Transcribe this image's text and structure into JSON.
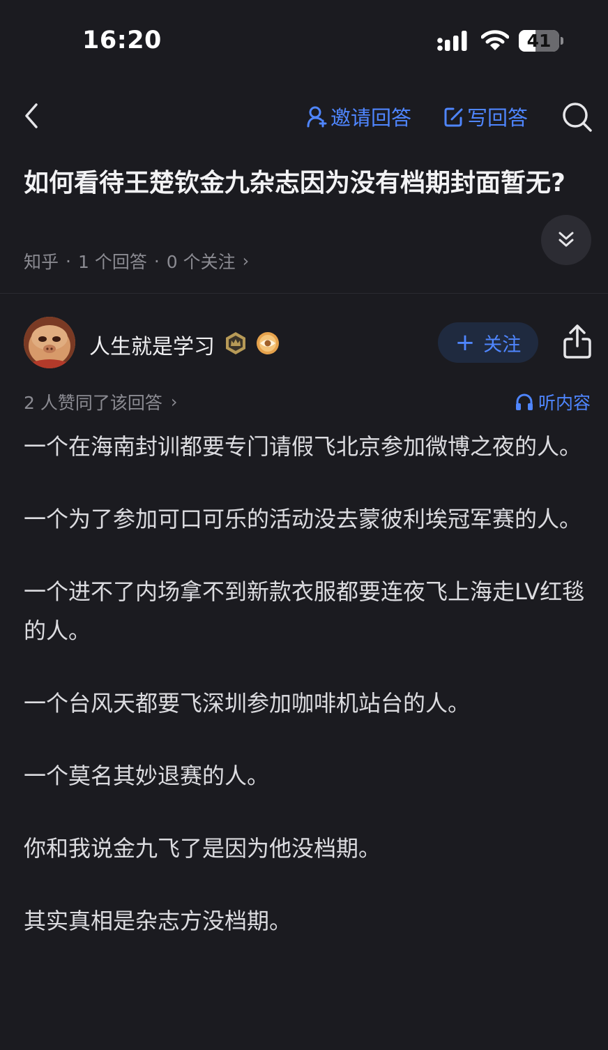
{
  "status_bar": {
    "time": "16:20",
    "battery_level": "41",
    "battery_percent": 41,
    "icons": [
      "signal-icon",
      "wifi-icon",
      "battery-icon"
    ]
  },
  "nav": {
    "back_icon": "chevron-left-icon",
    "invite_label": "邀请回答",
    "write_label": "写回答",
    "search_icon": "search-icon",
    "accent_color": "#4f86ff"
  },
  "question": {
    "title": "如何看待王楚钦金九杂志因为没有档期封面暂无?",
    "meta": {
      "source": "知乎",
      "answers": "1 个回答",
      "follows": "0 个关注"
    }
  },
  "answer": {
    "author": {
      "name": "人生就是学习",
      "badges": [
        "crown-badge-icon",
        "eye-badge-icon"
      ]
    },
    "follow_label": "关注",
    "upvote_text": "2 人赞同了该回答",
    "listen_label": "听内容",
    "paragraphs": [
      "一个在海南封训都要专门请假飞北京参加微博之夜的人。",
      "一个为了参加可口可乐的活动没去蒙彼利埃冠军赛的人。",
      "一个进不了内场拿不到新款衣服都要连夜飞上海走LV红毯的人。",
      "一个台风天都要飞深圳参加咖啡机站台的人。",
      "一个莫名其妙退赛的人。",
      "你和我说金九飞了是因为他没档期。",
      "其实真相是杂志方没档期。"
    ]
  }
}
